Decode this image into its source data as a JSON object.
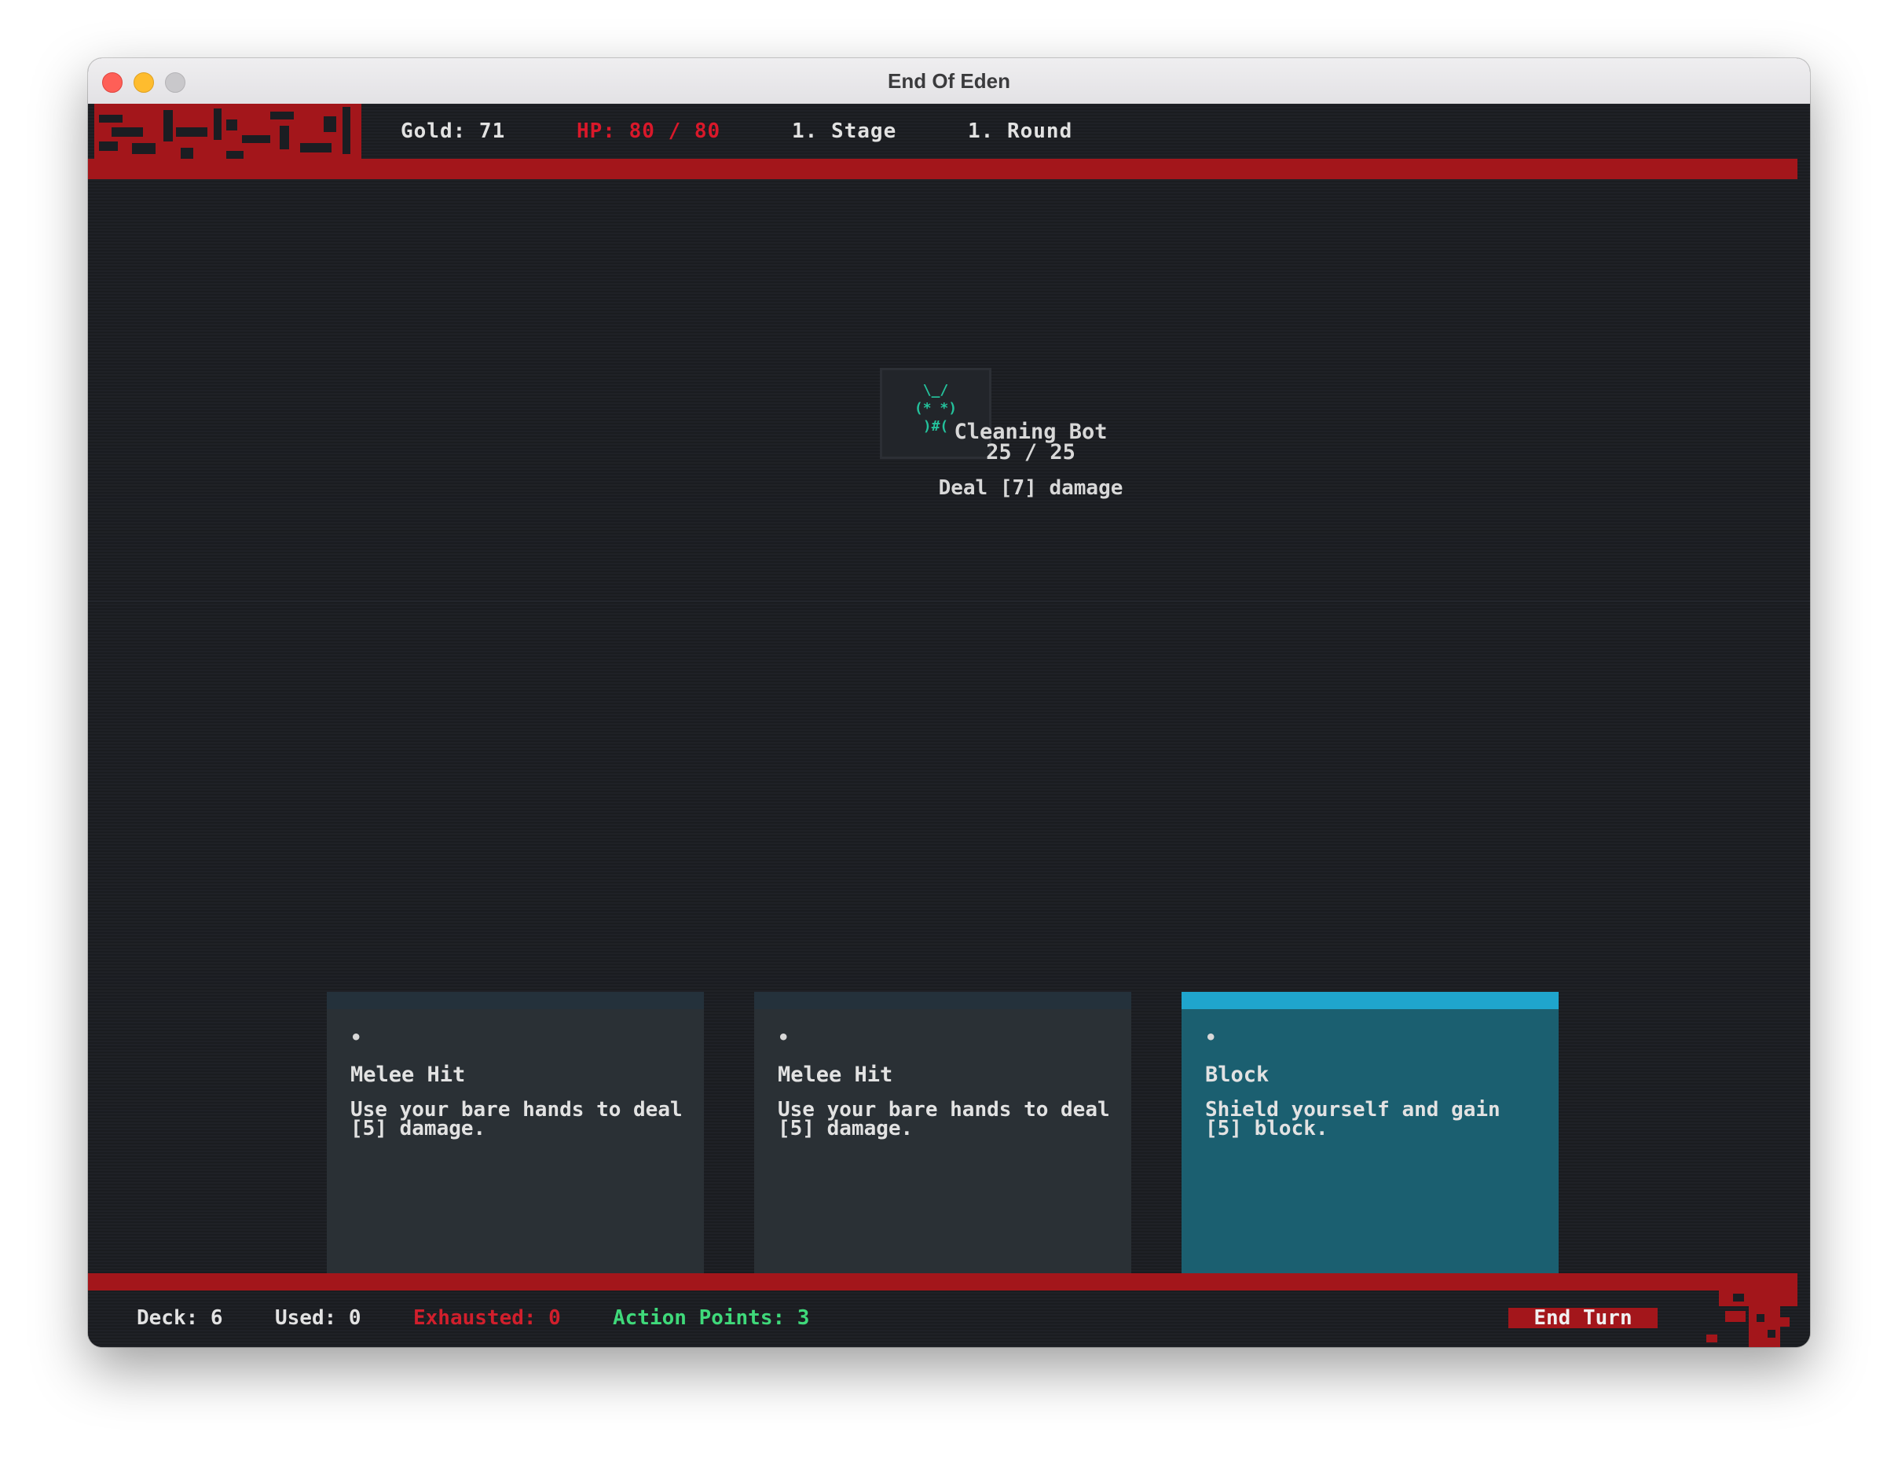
{
  "window": {
    "title": "End Of Eden"
  },
  "header": {
    "gold": "Gold: 71",
    "hp": "HP: 80 / 80",
    "stage": "1. Stage",
    "round": "1. Round"
  },
  "enemy": {
    "ascii_art": "\\_/\n(* *)\n)#(",
    "name": "Cleaning Bot",
    "hp": "25 / 25",
    "intent": "Deal [7] damage"
  },
  "hand": [
    {
      "dot": "•",
      "title": "Melee Hit",
      "description": "Use your bare hands to deal [5] damage.",
      "selected": false
    },
    {
      "dot": "•",
      "title": "Melee Hit",
      "description": "Use your bare hands to deal [5] damage.",
      "selected": false
    },
    {
      "dot": "•",
      "title": "Block",
      "description": "Shield yourself and gain [5] block.",
      "selected": true
    }
  ],
  "footer": {
    "deck": "Deck: 6",
    "used": "Used: 0",
    "exhausted": "Exhausted: 0",
    "action_points": "Action Points: 3",
    "end_turn_label": "End Turn"
  },
  "colors": {
    "accent_red": "#a3161b",
    "hp_red": "#d9182a",
    "exhausted_red": "#d11f2c",
    "action_green": "#3fd97a",
    "enemy_teal": "#24c29c",
    "selected_card": "#1b5f70",
    "selected_stripe": "#1fa5cd"
  }
}
